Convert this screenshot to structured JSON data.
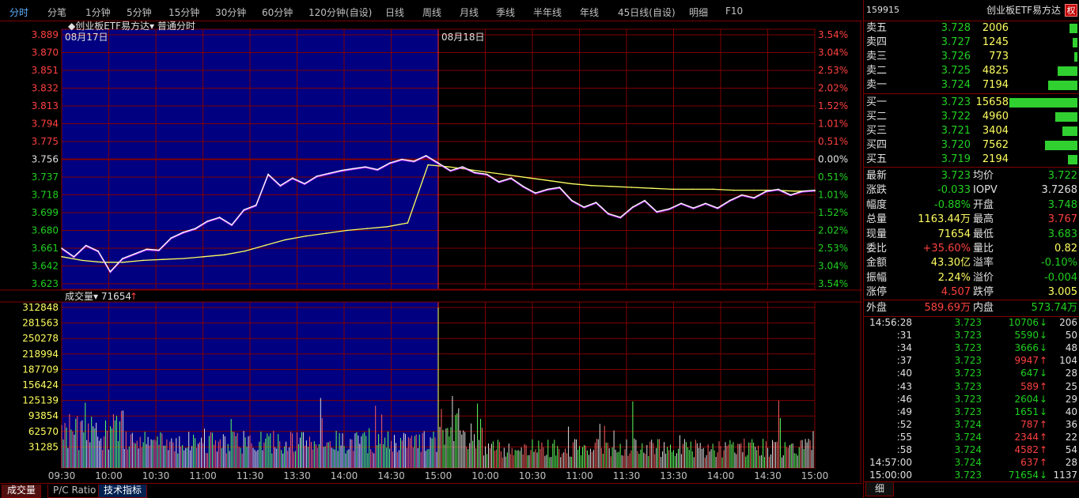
{
  "toolbar": {
    "tabs": [
      "分时",
      "分笔",
      "1分钟",
      "5分钟",
      "15分钟",
      "30分钟",
      "60分钟",
      "120分钟(自设)",
      "日线",
      "周线",
      "月线",
      "季线",
      "半年线",
      "年线",
      "45日线(自设)",
      "明细",
      "F10"
    ],
    "active_tab": "分时"
  },
  "chart_header": {
    "title": "创业板ETF易方达",
    "mode": "普通分时",
    "date1": "08月17日",
    "date2": "08月18日"
  },
  "volume_header": {
    "label": "成交量",
    "value": "71654"
  },
  "bottom_tabs": [
    "成交量",
    "P/C Ratio",
    "技术指标"
  ],
  "colors": {
    "frame": "#800000",
    "up": "#ff4040",
    "down": "#20d020",
    "price_line": "#ffffff",
    "avg_line": "#ffff60",
    "bg_prev_day": "#000080"
  },
  "chart_data": [
    {
      "type": "line",
      "title": "创业板ETF易方达 普通分时",
      "y_ticks_left": [
        "3.889",
        "3.870",
        "3.851",
        "3.832",
        "3.813",
        "3.794",
        "3.775",
        "3.756",
        "3.737",
        "3.718",
        "3.699",
        "3.680",
        "3.661",
        "3.642",
        "3.623"
      ],
      "y_ticks_right": [
        "3.54%",
        "3.04%",
        "2.53%",
        "2.02%",
        "1.52%",
        "1.01%",
        "0.51%",
        "0.00%",
        "0.51%",
        "1.01%",
        "1.52%",
        "2.02%",
        "2.53%",
        "3.04%",
        "3.54%"
      ],
      "x_ticks": [
        "09:30",
        "10:00",
        "10:30",
        "11:00",
        "11:30",
        "13:30",
        "14:00",
        "14:30",
        "15:00",
        "10:00",
        "10:30",
        "11:00",
        "11:30",
        "13:30",
        "14:00",
        "14:30",
        "15:00"
      ],
      "ylim": [
        3.623,
        3.889
      ],
      "prev_close": 3.756,
      "series": [
        {
          "values": [
            3.661,
            3.652,
            3.664,
            3.658,
            3.636,
            3.65,
            3.655,
            3.66,
            3.659,
            3.672,
            3.678,
            3.682,
            3.69,
            3.694,
            3.686,
            3.702,
            3.707,
            3.74,
            3.728,
            3.736,
            3.73,
            3.738,
            3.741,
            3.744,
            3.746,
            3.748,
            3.745,
            3.752,
            3.756,
            3.754,
            3.76,
            3.752,
            3.744,
            3.748,
            3.742,
            3.74,
            3.732,
            3.736,
            3.727,
            3.72,
            3.724,
            3.726,
            3.712,
            3.705,
            3.71,
            3.698,
            3.694,
            3.705,
            3.712,
            3.7,
            3.703,
            3.709,
            3.704,
            3.709,
            3.704,
            3.712,
            3.718,
            3.715,
            3.722,
            3.724,
            3.718,
            3.722,
            3.723
          ]
        },
        {
          "values": [
            3.652,
            3.648,
            3.646,
            3.646,
            3.648,
            3.649,
            3.65,
            3.652,
            3.654,
            3.658,
            3.664,
            3.67,
            3.674,
            3.677,
            3.68,
            3.682,
            3.684,
            3.688,
            3.75,
            3.748,
            3.745,
            3.742,
            3.739,
            3.736,
            3.733,
            3.73,
            3.728,
            3.727,
            3.726,
            3.725,
            3.724,
            3.724,
            3.724,
            3.723,
            3.723,
            3.723,
            3.722,
            3.722
          ]
        }
      ]
    },
    {
      "type": "bar",
      "title": "成交量",
      "y_ticks": [
        "312848",
        "281563",
        "250278",
        "218994",
        "187709",
        "156424",
        "125139",
        "93854",
        "62570",
        "31285"
      ],
      "ylim": [
        0,
        312848
      ],
      "max_value": 312848,
      "last_value": 71654
    }
  ],
  "quote": {
    "code": "159915",
    "name": "创业板ETF易方达",
    "badge": "权",
    "asks": [
      {
        "label": "卖五",
        "price": "3.728",
        "vol": "2006",
        "frac": 0.13
      },
      {
        "label": "卖四",
        "price": "3.727",
        "vol": "1245",
        "frac": 0.08
      },
      {
        "label": "卖三",
        "price": "3.726",
        "vol": "773",
        "frac": 0.05
      },
      {
        "label": "卖二",
        "price": "3.725",
        "vol": "4825",
        "frac": 0.31
      },
      {
        "label": "卖一",
        "price": "3.724",
        "vol": "7194",
        "frac": 0.46
      }
    ],
    "bids": [
      {
        "label": "买一",
        "price": "3.723",
        "vol": "15658",
        "frac": 1.0
      },
      {
        "label": "买二",
        "price": "3.722",
        "vol": "4960",
        "frac": 0.32
      },
      {
        "label": "买三",
        "price": "3.721",
        "vol": "3404",
        "frac": 0.22
      },
      {
        "label": "买四",
        "price": "3.720",
        "vol": "7562",
        "frac": 0.48
      },
      {
        "label": "买五",
        "price": "3.719",
        "vol": "2194",
        "frac": 0.14
      }
    ],
    "stats": [
      {
        "l1": "最新",
        "v1": "3.723",
        "c1": "dn",
        "l2": "均价",
        "v2": "3.722",
        "c2": "dn"
      },
      {
        "l1": "涨跌",
        "v1": "-0.033",
        "c1": "dn",
        "l2": "IOPV",
        "v2": "3.7268",
        "c2": "wt"
      },
      {
        "l1": "幅度",
        "v1": "-0.88%",
        "c1": "dn",
        "l2": "开盘",
        "v2": "3.748",
        "c2": "dn"
      },
      {
        "l1": "总量",
        "v1": "1163.44万",
        "c1": "yl",
        "l2": "最高",
        "v2": "3.767",
        "c2": "up"
      },
      {
        "l1": "现量",
        "v1": "71654",
        "c1": "yl",
        "l2": "最低",
        "v2": "3.683",
        "c2": "dn"
      },
      {
        "l1": "委比",
        "v1": "+35.60%",
        "c1": "up",
        "l2": "量比",
        "v2": "0.82",
        "c2": "yl"
      },
      {
        "l1": "金额",
        "v1": "43.30亿",
        "c1": "yl",
        "l2": "溢率",
        "v2": "-0.10%",
        "c2": "dn"
      },
      {
        "l1": "振幅",
        "v1": "2.24%",
        "c1": "yl",
        "l2": "溢价",
        "v2": "-0.004",
        "c2": "dn"
      },
      {
        "l1": "涨停",
        "v1": "4.507",
        "c1": "up",
        "l2": "跌停",
        "v2": "3.005",
        "c2": "yl"
      }
    ],
    "outer": {
      "label": "外盘",
      "value": "589.69万"
    },
    "inner": {
      "label": "内盘",
      "value": "573.74万"
    },
    "ticks": [
      {
        "time": "14:56:28",
        "price": "3.723",
        "vol": "10706",
        "dir": "↓",
        "cnt": "206"
      },
      {
        "time": ":31",
        "price": "3.723",
        "vol": "5590",
        "dir": "↓",
        "cnt": "50"
      },
      {
        "time": ":34",
        "price": "3.723",
        "vol": "3666",
        "dir": "↓",
        "cnt": "48"
      },
      {
        "time": ":37",
        "price": "3.723",
        "vol": "9947",
        "dir": "↑",
        "cnt": "104"
      },
      {
        "time": ":40",
        "price": "3.723",
        "vol": "647",
        "dir": "↓",
        "cnt": "28"
      },
      {
        "time": ":43",
        "price": "3.723",
        "vol": "589",
        "dir": "↑",
        "cnt": "25"
      },
      {
        "time": ":46",
        "price": "3.723",
        "vol": "2604",
        "dir": "↓",
        "cnt": "29"
      },
      {
        "time": ":49",
        "price": "3.723",
        "vol": "1651",
        "dir": "↓",
        "cnt": "40"
      },
      {
        "time": ":52",
        "price": "3.724",
        "vol": "787",
        "dir": "↑",
        "cnt": "36"
      },
      {
        "time": ":55",
        "price": "3.724",
        "vol": "2344",
        "dir": "↑",
        "cnt": "22"
      },
      {
        "time": ":58",
        "price": "3.724",
        "vol": "4582",
        "dir": "↑",
        "cnt": "54"
      },
      {
        "time": "14:57:00",
        "price": "3.724",
        "vol": "637",
        "dir": "↑",
        "cnt": "28"
      },
      {
        "time": "15:00:00",
        "price": "3.723",
        "vol": "71654",
        "dir": "↓",
        "cnt": "1137"
      }
    ],
    "bottom_tab": "细"
  }
}
